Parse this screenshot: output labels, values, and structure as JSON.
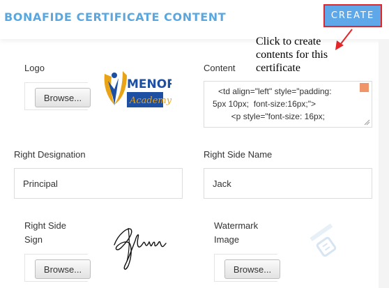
{
  "header": {
    "title": "BONAFIDE CERTIFICATE CONTENT",
    "create_label": "CREATE"
  },
  "annotation": {
    "line1": "Click to create",
    "line2": "contents for this",
    "line3": "certificate"
  },
  "logo_field": {
    "label": "Logo",
    "browse_label": "Browse...",
    "brand_name": "MENORAH",
    "brand_sub": "Academy"
  },
  "content_field": {
    "label": "Content",
    "lines": [
      "<td align=\"left\" style=\"padding:",
      "5px 10px;  font-size:16px;\">",
      "        <p style=\"font-size: 16px;"
    ]
  },
  "right_designation": {
    "label": "Right Designation",
    "value": "Principal"
  },
  "right_side_name": {
    "label": "Right Side Name",
    "value": "Jack"
  },
  "right_side_sign": {
    "label_line1": "Right Side",
    "label_line2": "Sign",
    "browse_label": "Browse..."
  },
  "watermark_image": {
    "label_line1": "Watermark",
    "label_line2": "Image",
    "browse_label": "Browse..."
  },
  "colors": {
    "accent": "#5aa7e0",
    "button": "#5ea8e9",
    "highlight": "#e2262a",
    "logo_blue": "#1d4fa3",
    "logo_gold": "#e8a317"
  }
}
